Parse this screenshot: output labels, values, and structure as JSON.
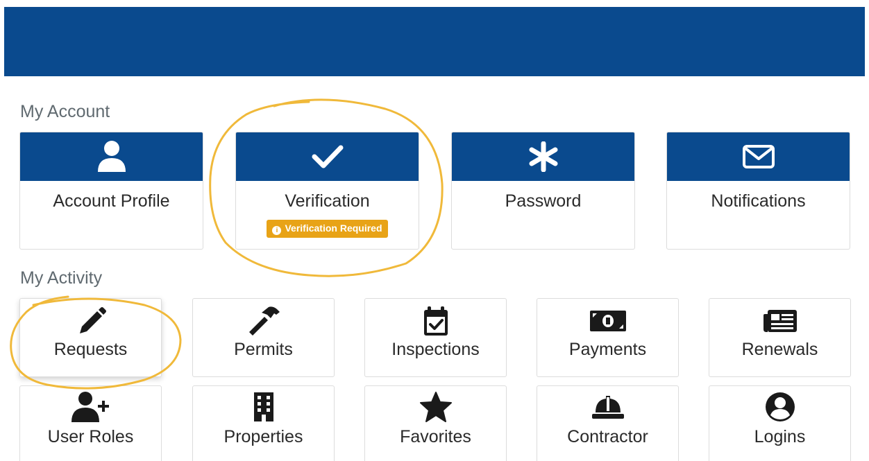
{
  "sections": {
    "account_title": "My Account",
    "activity_title": "My Activity"
  },
  "account_cards": [
    {
      "label": "Account Profile",
      "icon": "user-icon"
    },
    {
      "label": "Verification",
      "icon": "check-icon",
      "badge": "Verification Required"
    },
    {
      "label": "Password",
      "icon": "asterisk-icon"
    },
    {
      "label": "Notifications",
      "icon": "envelope-icon"
    }
  ],
  "activity_cards": [
    {
      "label": "Requests",
      "icon": "pencil-icon"
    },
    {
      "label": "Permits",
      "icon": "hammer-icon"
    },
    {
      "label": "Inspections",
      "icon": "calendar-check-icon"
    },
    {
      "label": "Payments",
      "icon": "money-bill-icon"
    },
    {
      "label": "Renewals",
      "icon": "newspaper-icon"
    },
    {
      "label": "User Roles",
      "icon": "user-plus-icon"
    },
    {
      "label": "Properties",
      "icon": "building-icon"
    },
    {
      "label": "Favorites",
      "icon": "star-icon"
    },
    {
      "label": "Contractor",
      "icon": "hard-hat-icon"
    },
    {
      "label": "Logins",
      "icon": "user-circle-icon"
    }
  ],
  "colors": {
    "brand_blue": "#0a4a8e",
    "badge_orange": "#e8a317",
    "annotation_yellow": "#f0b93a"
  }
}
